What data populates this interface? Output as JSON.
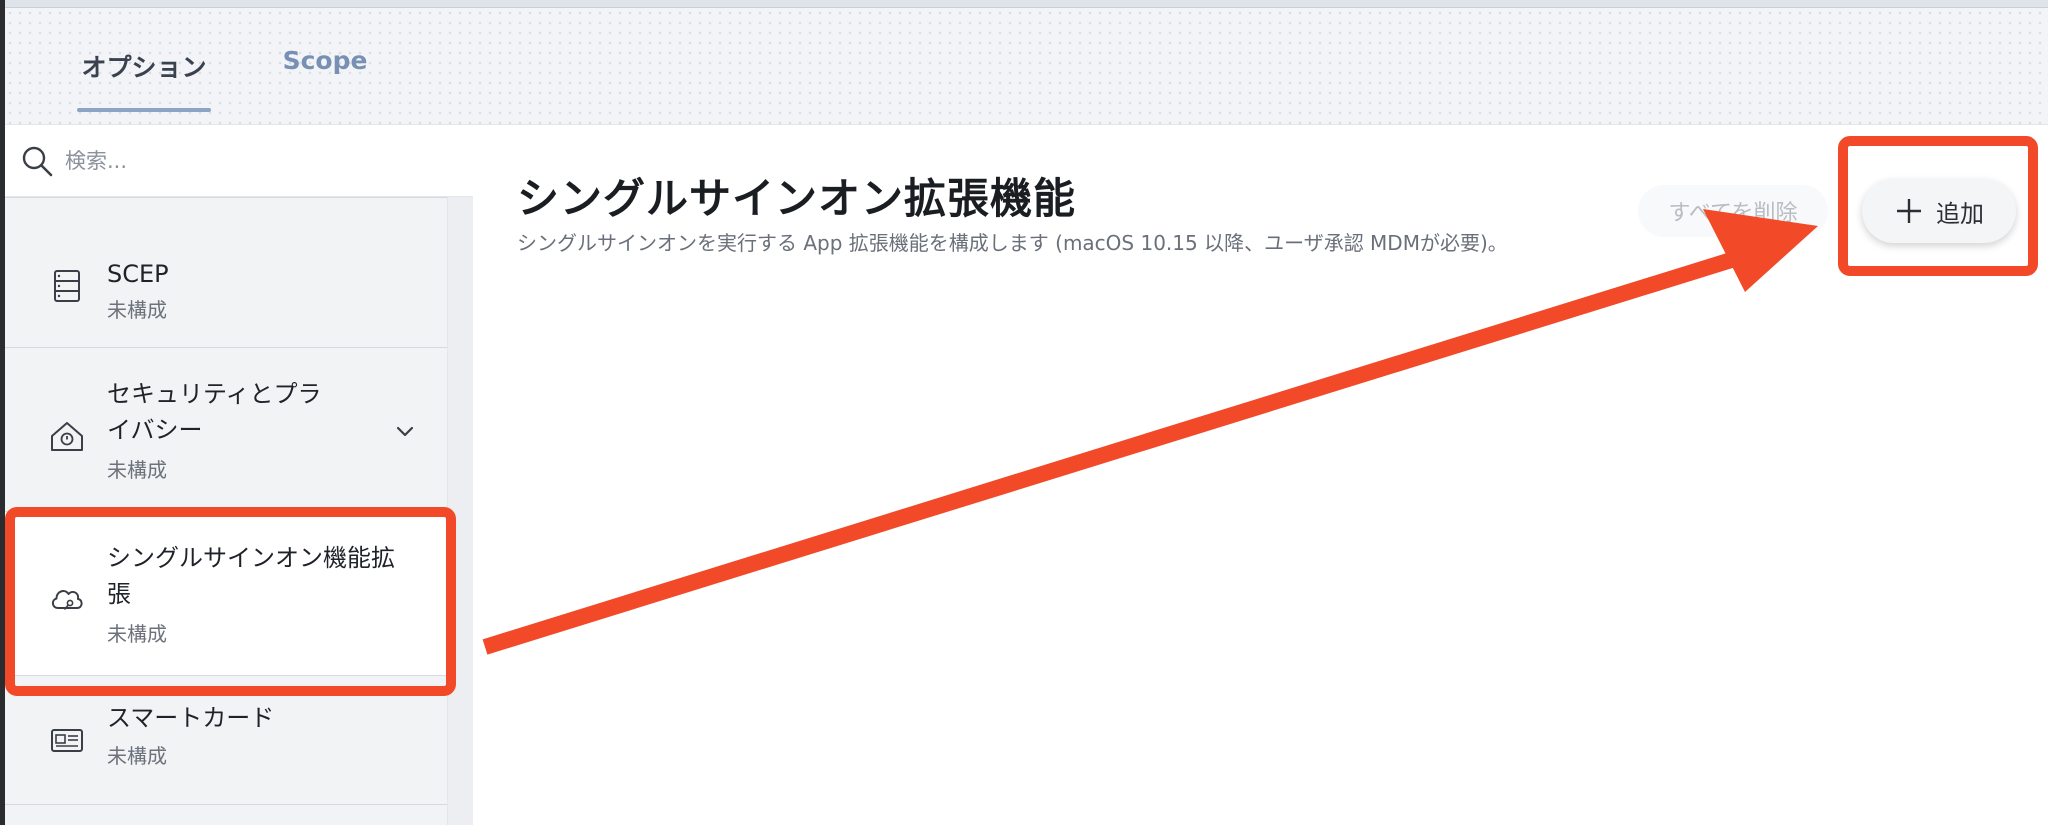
{
  "tabs": [
    {
      "label": "オプション",
      "active": true
    },
    {
      "label": "Scope",
      "active": false
    }
  ],
  "search": {
    "placeholder": "検索..."
  },
  "sidebar": {
    "items": [
      {
        "title": "SCEP",
        "status": "未構成",
        "icon": "server-icon"
      },
      {
        "title_lines": [
          "セキュリティとプラ",
          "イバシー"
        ],
        "status": "未構成",
        "icon": "security-house-icon"
      },
      {
        "title_lines": [
          "シングルサインオン機能拡",
          "張"
        ],
        "status": "未構成",
        "icon": "cloud-key-icon",
        "active": true
      },
      {
        "title": "スマートカード",
        "status": "未構成",
        "icon": "smartcard-icon"
      }
    ]
  },
  "main": {
    "title": "シングルサインオン拡張機能",
    "description": "シングルサインオンを実行する App 拡張機能を構成します (macOS 10.15 以降、ユーザ承認 MDMが必要)。",
    "delete_all_label": "すべてを削除",
    "add_label": "追加"
  },
  "colors": {
    "annotation": "#f24a28",
    "active_indicator": "#2f6fd6",
    "tab_underline": "#8ea4c4"
  }
}
